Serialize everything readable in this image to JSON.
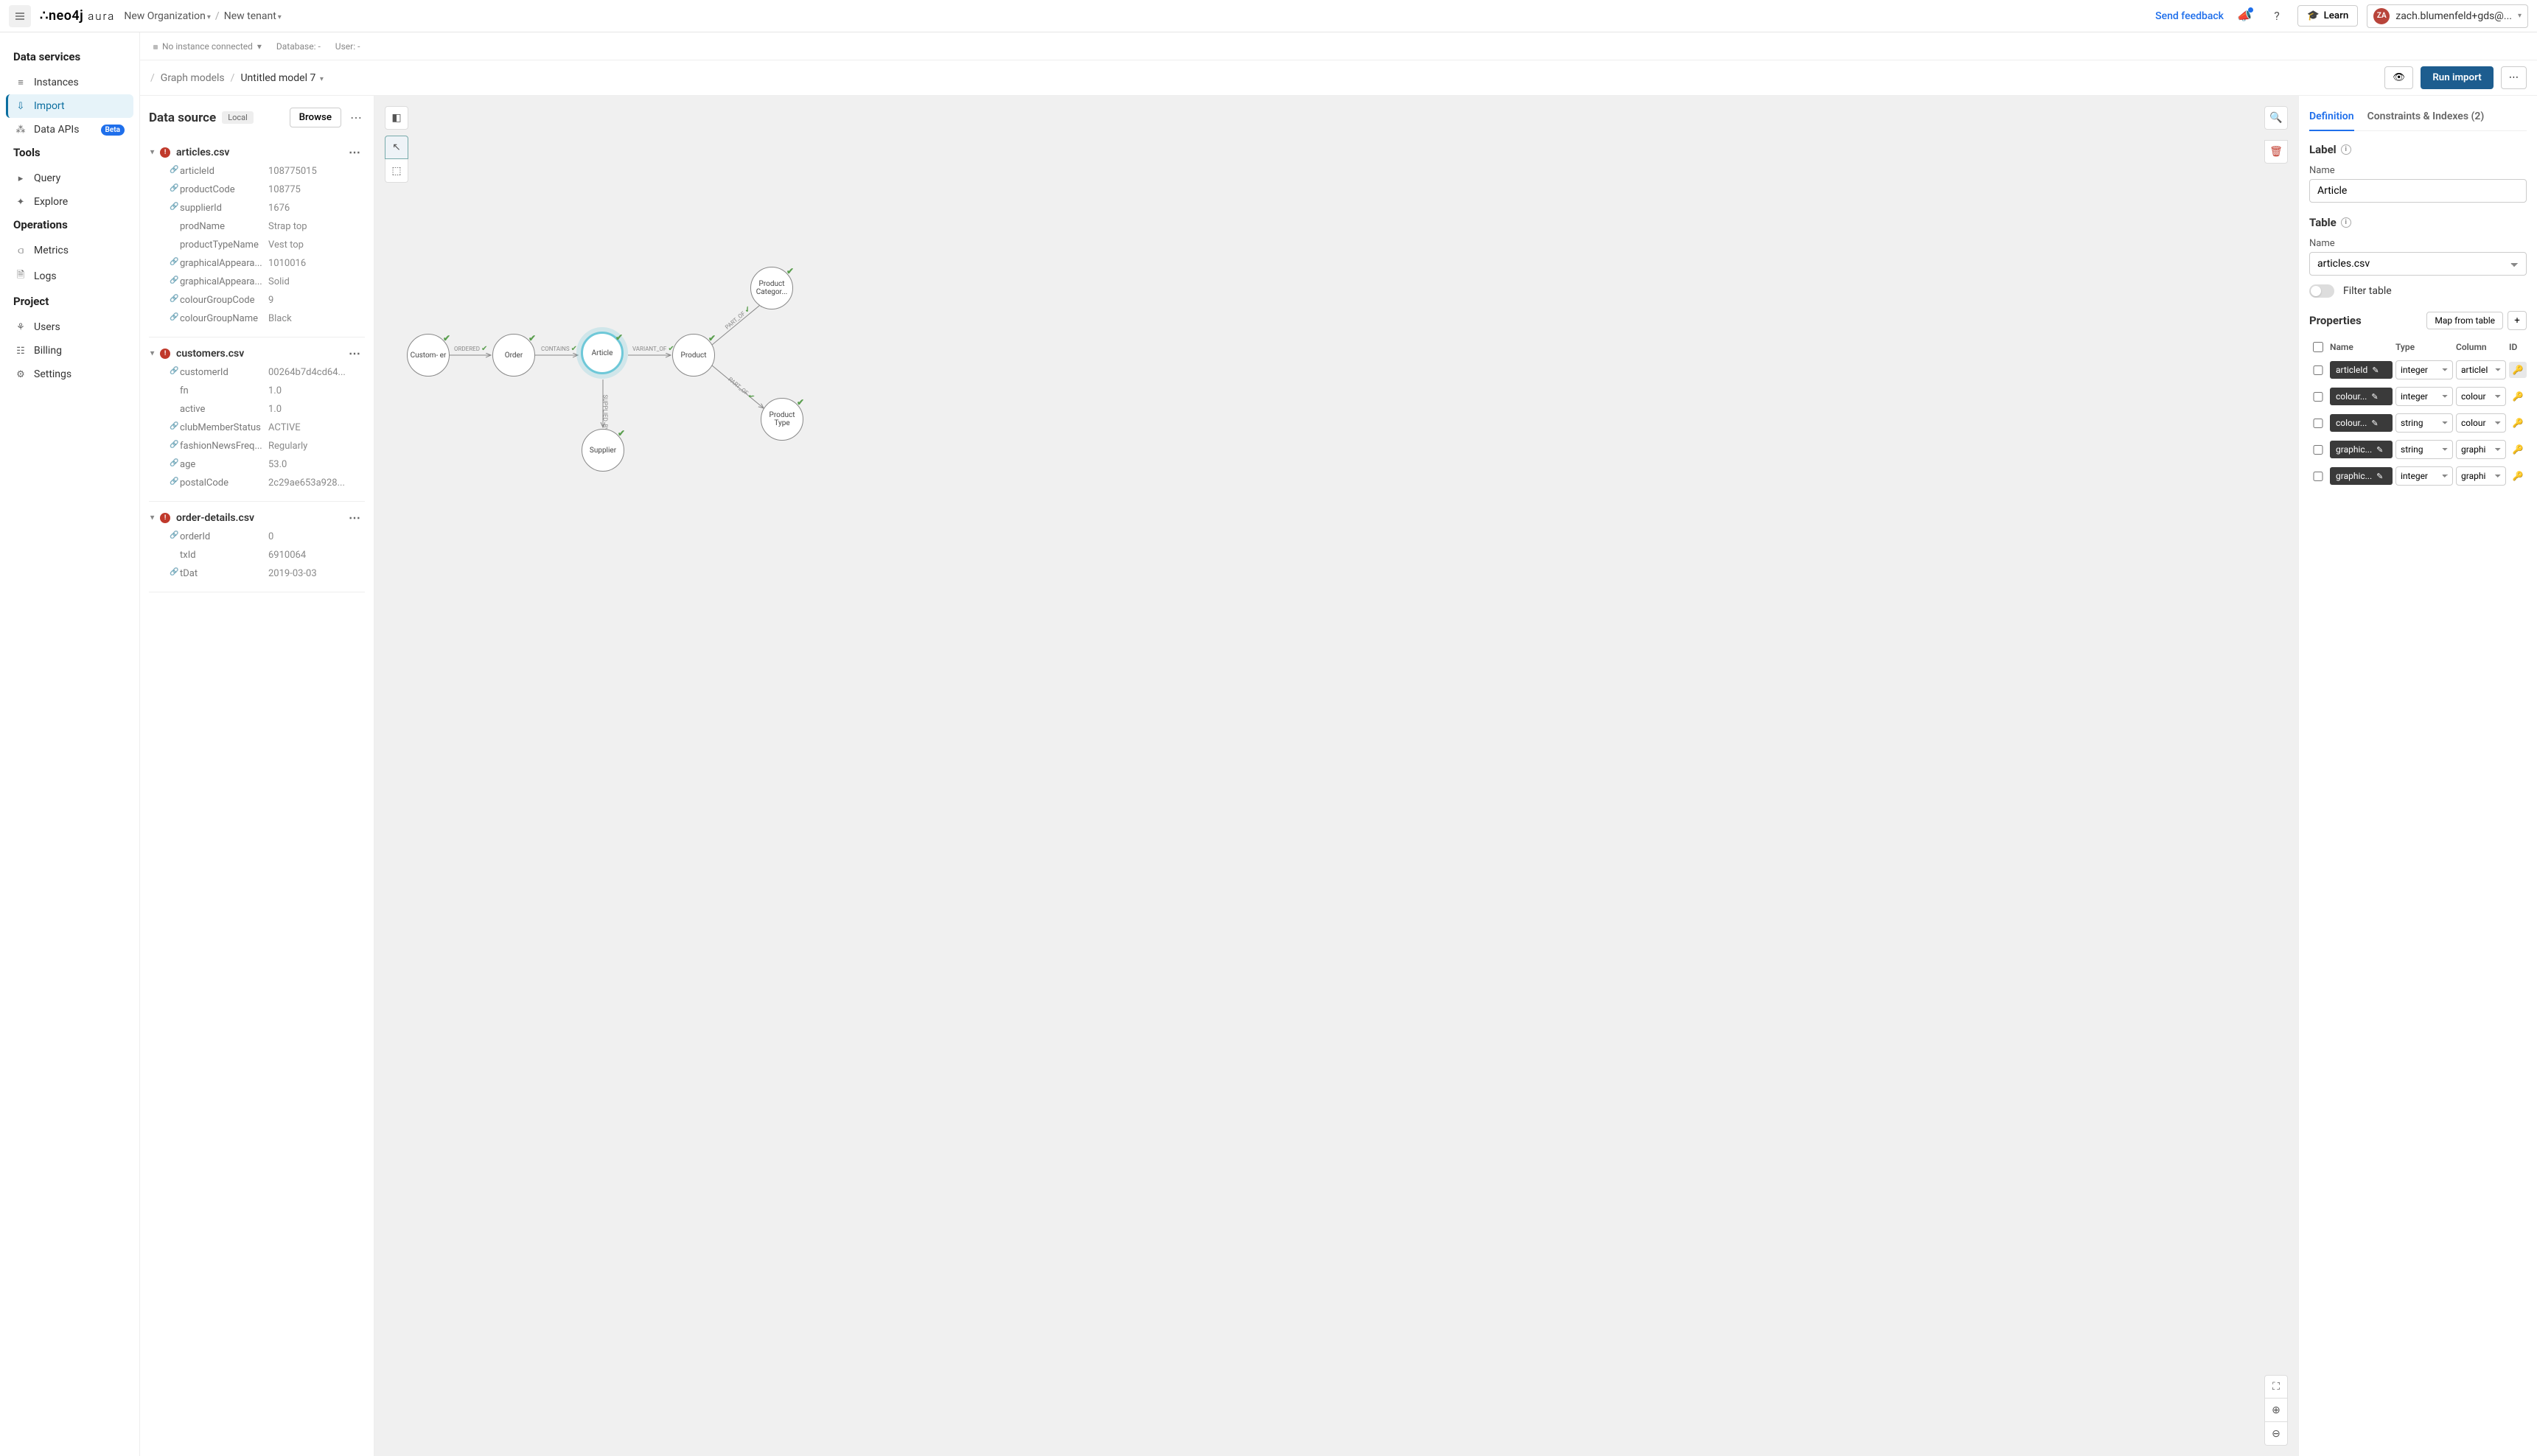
{
  "topbar": {
    "org": "New Organization",
    "tenant": "New tenant",
    "feedback": "Send feedback",
    "learn": "Learn",
    "avatar_initials": "ZA",
    "user_email": "zach.blumenfeld+gds@..."
  },
  "sidebar": {
    "groups": [
      {
        "title": "Data services",
        "items": [
          {
            "icon": "database-icon",
            "glyph": "≡",
            "label": "Instances",
            "active": false
          },
          {
            "icon": "import-icon",
            "glyph": "⇩",
            "label": "Import",
            "active": true
          },
          {
            "icon": "api-icon",
            "glyph": "⁂",
            "label": "Data APIs",
            "badge": "Beta"
          }
        ]
      },
      {
        "title": "Tools",
        "items": [
          {
            "icon": "query-icon",
            "glyph": "▸",
            "label": "Query"
          },
          {
            "icon": "explore-icon",
            "glyph": "✦",
            "label": "Explore"
          }
        ]
      },
      {
        "title": "Operations",
        "items": [
          {
            "icon": "metrics-icon",
            "glyph": "⫏",
            "label": "Metrics"
          },
          {
            "icon": "logs-icon",
            "glyph": "🗎",
            "label": "Logs"
          }
        ]
      },
      {
        "title": "Project",
        "items": [
          {
            "icon": "users-icon",
            "glyph": "⚘",
            "label": "Users"
          },
          {
            "icon": "billing-icon",
            "glyph": "☷",
            "label": "Billing"
          },
          {
            "icon": "settings-icon",
            "glyph": "⚙",
            "label": "Settings"
          }
        ]
      }
    ]
  },
  "context": {
    "instance": "No instance connected",
    "database_label": "Database:",
    "database_value": "-",
    "user_label": "User:",
    "user_value": "-"
  },
  "breadcrumb": {
    "parent": "Graph models",
    "current": "Untitled model 7",
    "run_import": "Run import"
  },
  "datasource": {
    "title": "Data source",
    "pill": "Local",
    "browse": "Browse",
    "files": [
      {
        "name": "articles.csv",
        "warn": true,
        "fields": [
          {
            "link": true,
            "name": "articleId",
            "value": "108775015"
          },
          {
            "link": true,
            "name": "productCode",
            "value": "108775"
          },
          {
            "link": true,
            "name": "supplierId",
            "value": "1676"
          },
          {
            "link": false,
            "name": "prodName",
            "value": "Strap top"
          },
          {
            "link": false,
            "name": "productTypeName",
            "value": "Vest top"
          },
          {
            "link": true,
            "name": "graphicalAppeara...",
            "value": "1010016"
          },
          {
            "link": true,
            "name": "graphicalAppeara...",
            "value": "Solid"
          },
          {
            "link": true,
            "name": "colourGroupCode",
            "value": "9"
          },
          {
            "link": true,
            "name": "colourGroupName",
            "value": "Black"
          }
        ]
      },
      {
        "name": "customers.csv",
        "warn": true,
        "fields": [
          {
            "link": true,
            "name": "customerId",
            "value": "00264b7d4cd64..."
          },
          {
            "link": false,
            "name": "fn",
            "value": "1.0"
          },
          {
            "link": false,
            "name": "active",
            "value": "1.0"
          },
          {
            "link": true,
            "name": "clubMemberStatus",
            "value": "ACTIVE"
          },
          {
            "link": true,
            "name": "fashionNewsFreq...",
            "value": "Regularly"
          },
          {
            "link": true,
            "name": "age",
            "value": "53.0"
          },
          {
            "link": true,
            "name": "postalCode",
            "value": "2c29ae653a928..."
          }
        ]
      },
      {
        "name": "order-details.csv",
        "warn": true,
        "fields": [
          {
            "link": true,
            "name": "orderId",
            "value": "0"
          },
          {
            "link": false,
            "name": "txId",
            "value": "6910064"
          },
          {
            "link": true,
            "name": "tDat",
            "value": "2019-03-03"
          }
        ]
      }
    ]
  },
  "graph": {
    "nodes": {
      "customer": "Custom-\ner",
      "order": "Order",
      "article": "Article",
      "product": "Product",
      "supplier": "Supplier",
      "product_type": "Product Type",
      "product_category": "Product Categor..."
    },
    "edges": {
      "ordered": "ORDERED",
      "contains": "CONTAINS",
      "variant_of": "VARIANT_OF",
      "supplied_by": "SUPPLIED_BY",
      "part_of1": "PART_OF",
      "part_of2": "PART_OF"
    }
  },
  "details": {
    "tabs": {
      "definition": "Definition",
      "constraints": "Constraints & Indexes (2)"
    },
    "label_section": "Label",
    "name_label": "Name",
    "name_value": "Article",
    "table_section": "Table",
    "table_value": "articles.csv",
    "filter_label": "Filter table",
    "properties_title": "Properties",
    "map_button": "Map from table",
    "cols": {
      "name": "Name",
      "type": "Type",
      "column": "Column",
      "id": "ID"
    },
    "rows": [
      {
        "name": "articleId",
        "type": "integer",
        "column": "articleI",
        "key": true
      },
      {
        "name": "colour...",
        "type": "integer",
        "column": "colour",
        "key": false
      },
      {
        "name": "colour...",
        "type": "string",
        "column": "colour",
        "key": false
      },
      {
        "name": "graphic...",
        "type": "string",
        "column": "graphi",
        "key": false
      },
      {
        "name": "graphic...",
        "type": "integer",
        "column": "graphi",
        "key": false
      }
    ]
  }
}
